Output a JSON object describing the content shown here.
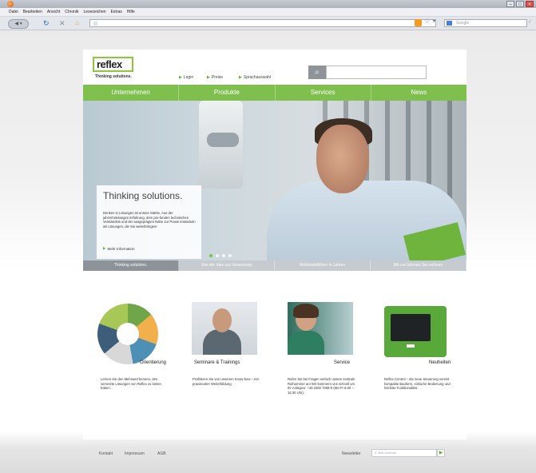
{
  "browser": {
    "menu": [
      "Datei",
      "Bearbeiten",
      "Ansicht",
      "Chronik",
      "Lesezeichen",
      "Extras",
      "Hilfe"
    ],
    "search_placeholder": "Google"
  },
  "header": {
    "logo_text": "reflex",
    "tagline": "Thinking solutions.",
    "links": [
      "Login",
      "Preise",
      "Sprachauswahl"
    ]
  },
  "nav": {
    "tabs": [
      "Unternehmen",
      "Produkte",
      "Services",
      "News"
    ]
  },
  "hero": {
    "title": "Thinking solutions.",
    "text": "Denken in Lösungen ist unsere Stärke. Aus der jahrzehntelangen Erfahrung, dem pro-funden technischen Verständnis und der ausgeprägten Nähe zur Praxis entwickeln wir Lösungen, die Sie weiterbringen!",
    "more": "Mehr Information",
    "strip": [
      "Thinking solutions.",
      "Von der Idee zur Umsetzung",
      "Weltmarktführer in Jahren",
      "Mit uns können Sie rechnen"
    ]
  },
  "teasers": [
    {
      "label": "Orientierung",
      "text": "Lernen Sie den Mehrwert kennen, den vernetzte Lösungen von Reflex zu bieten haben."
    },
    {
      "label": "Seminare & Trainings",
      "text": "Profitieren Sie von unserem Know-how – mit praxisnaher Weiterbildung."
    },
    {
      "label": "Service",
      "text": "Rufen Sie bei Fragen einfach unsere zentrale Rufnummer an! Wir kümmern uns schnell um Ihr Anliegen: +49 2382 7069-0 (Mo-Fr 8.00 – 16.30 Uhr)."
    },
    {
      "label": "Neuheiten",
      "text": "Reflex Control – die neue Steuerung vereint kompakte Bauform, einfache Bedienung und höchste Funktionalität."
    }
  ],
  "footer": {
    "links": [
      "Kontakt",
      "Impressum",
      "AGB"
    ],
    "newsletter_label": "Newsletter",
    "newsletter_placeholder": "E-Mail-Adresse"
  },
  "colors": {
    "accent": "#7ebf4e",
    "accent_dark": "#62b12e"
  }
}
